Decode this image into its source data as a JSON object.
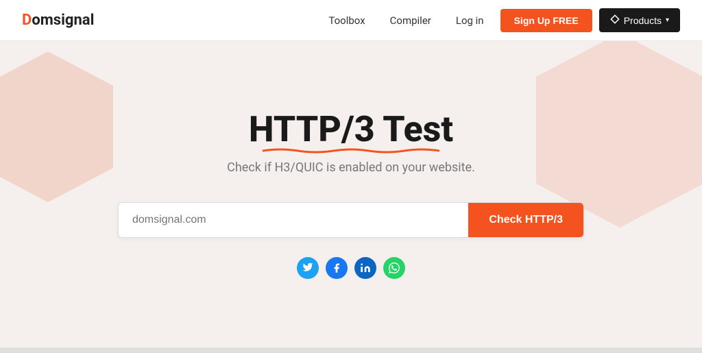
{
  "navbar": {
    "logo_prefix": "D",
    "logo_suffix": "omsignal",
    "links": [
      {
        "id": "toolbox",
        "label": "Toolbox"
      },
      {
        "id": "compiler",
        "label": "Compiler"
      },
      {
        "id": "login",
        "label": "Log in"
      }
    ],
    "signup_label": "Sign Up FREE",
    "products_label": "Products"
  },
  "hero": {
    "title": "HTTP/3 Test",
    "subtitle": "Check if H3/QUIC is enabled on your website."
  },
  "search": {
    "placeholder": "domsignal.com",
    "button_label": "Check HTTP/3"
  },
  "social": [
    {
      "id": "twitter",
      "name": "Twitter",
      "class": "social-twitter",
      "icon": "𝕏"
    },
    {
      "id": "facebook",
      "name": "Facebook",
      "class": "social-facebook",
      "icon": "f"
    },
    {
      "id": "linkedin",
      "name": "LinkedIn",
      "class": "social-linkedin",
      "icon": "in"
    },
    {
      "id": "whatsapp",
      "name": "WhatsApp",
      "class": "social-whatsapp",
      "icon": "✓"
    }
  ],
  "colors": {
    "accent": "#f4521e",
    "dark": "#1a1a1a"
  }
}
